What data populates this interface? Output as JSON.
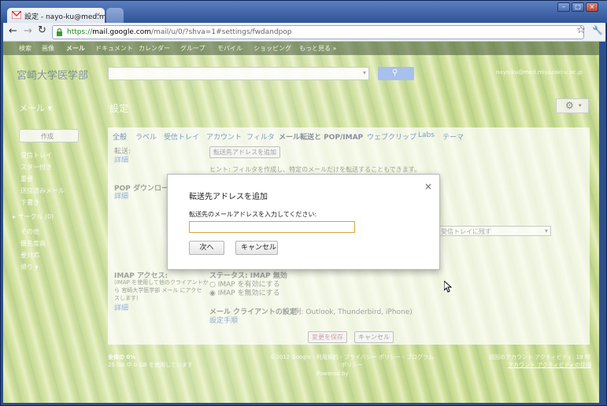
{
  "browser": {
    "tab_title": "設定 - nayo-ku@med.miyaz",
    "url_scheme": "https://",
    "url_host": "mail.google.com",
    "url_path": "/mail/u/0/?shva=1#settings/fwdandpop"
  },
  "gbar": {
    "items": [
      "検索",
      "画像",
      "メール",
      "ドキュメント",
      "カレンダー",
      "グループ",
      "モバイル",
      "ショッピング",
      "もっと見る »"
    ]
  },
  "header": {
    "org_logo": "宮崎大学医学部",
    "account_email": "nayo-ku@med.miyazaki-u.ac.jp",
    "mail_menu": "メール ▾",
    "page_title": "設定"
  },
  "sidebar": {
    "compose": "作成",
    "items": [
      "受信トレイ",
      "スター付き",
      "重要",
      "送信済みメール",
      "下書き",
      "▸ サークル (0)",
      "その他",
      "優先度高",
      "要対応",
      "帰り ▾"
    ]
  },
  "settings": {
    "tabs": [
      "全般",
      "ラベル",
      "受信トレイ",
      "アカウント",
      "フィルタ",
      "メール転送と POP/IMAP",
      "ウェブクリップ",
      "Labs",
      "テーマ"
    ],
    "forward_label": "転送:",
    "details": "詳細",
    "add_forward_button": "転送先アドレスを追加",
    "hint": "ヒント: フィルタを作成し、特定のメールだけを転送することもできます。",
    "pop_label": "POP ダウンロード:",
    "pop_select": "受信トレイに残す",
    "imap_label": "IMAP アクセス:",
    "imap_desc_1": "(IMAP を使用して他のクライアントか",
    "imap_desc_2": "ら 宮崎大学医学部 メール にアクセ",
    "imap_desc_3": "スします)",
    "imap_status": "ステータス: IMAP 無効",
    "imap_enable": "○ IMAP を有効にする",
    "imap_disable": "◉ IMAP を無効にする",
    "client_setup": "メール クライアントの設定",
    "client_examples": " (例: Outlook, Thunderbird, iPhone)",
    "setup_steps": "設定手順",
    "save_button": "変更を保存",
    "cancel_button": "キャンセル"
  },
  "footer": {
    "usage": "全体の 0%",
    "usage_detail": "25 GB 中 0 GB を使用しています",
    "copyright": "©2012 Google - 利用規約 - プライバシー ポリシー - プログラム ポリシー",
    "powered": "Powered by",
    "activity": "前回のアカウント アクティビティ: 19 時",
    "activity_link": "アカウント アクティビティの詳細"
  },
  "dialog": {
    "title": "転送先アドレスを追加",
    "close_glyph": "×",
    "prompt": "転送先のメールアドレスを入力してください:",
    "input_value": "",
    "next_button": "次へ",
    "cancel_button": "キャンセル"
  },
  "colors": {
    "accent_blue": "#7c99c8",
    "input_focus": "#d9a43a"
  }
}
